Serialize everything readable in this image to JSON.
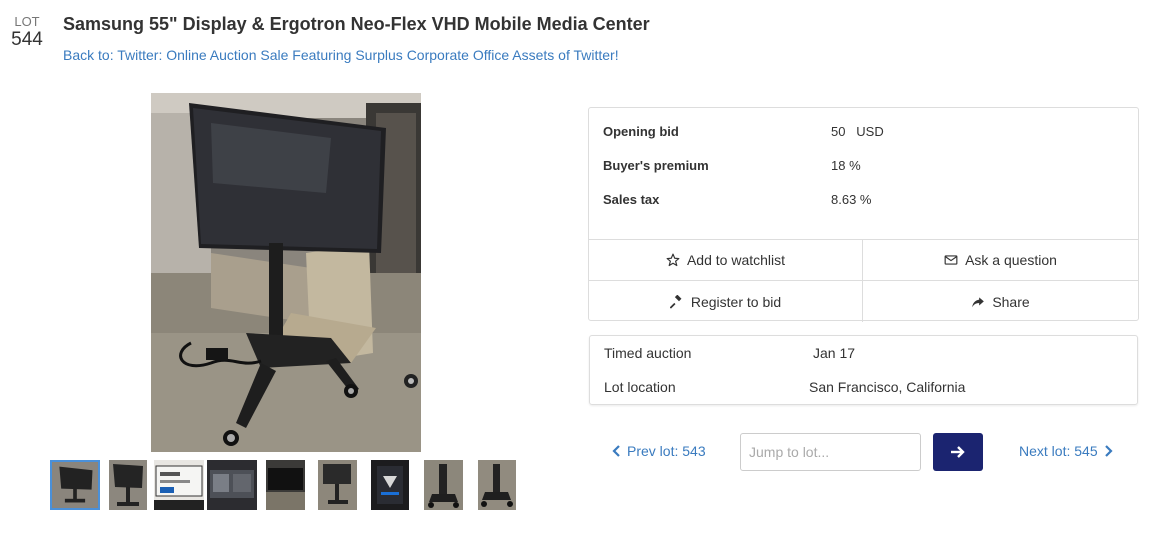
{
  "lot": {
    "word": "LOT",
    "number": "544"
  },
  "title": "Samsung 55\" Display & Ergotron Neo-Flex VHD Mobile Media Center",
  "back_link": "Back to: Twitter: Online Auction Sale Featuring Surplus Corporate Office Assets of Twitter!",
  "bid_info": {
    "opening_bid": {
      "label": "Opening bid",
      "value": "50   USD"
    },
    "buyers_premium": {
      "label": "Buyer's premium",
      "value": "18 %"
    },
    "sales_tax": {
      "label": "Sales tax",
      "value": "8.63 %"
    }
  },
  "actions": {
    "watchlist": "Add to watchlist",
    "ask": "Ask a question",
    "register": "Register to bid",
    "share": "Share"
  },
  "auction": {
    "type_label": "Timed auction",
    "date": "Jan 17",
    "location_label": "Lot location",
    "location": "San Francisco, California"
  },
  "nav": {
    "prev": "Prev lot: 543",
    "next": "Next lot: 545",
    "jump_placeholder": "Jump to lot..."
  },
  "colors": {
    "link": "#3a7bbf",
    "button": "#1b2470",
    "thumb_active": "#4a90d9"
  },
  "thumbnail_count": 9
}
